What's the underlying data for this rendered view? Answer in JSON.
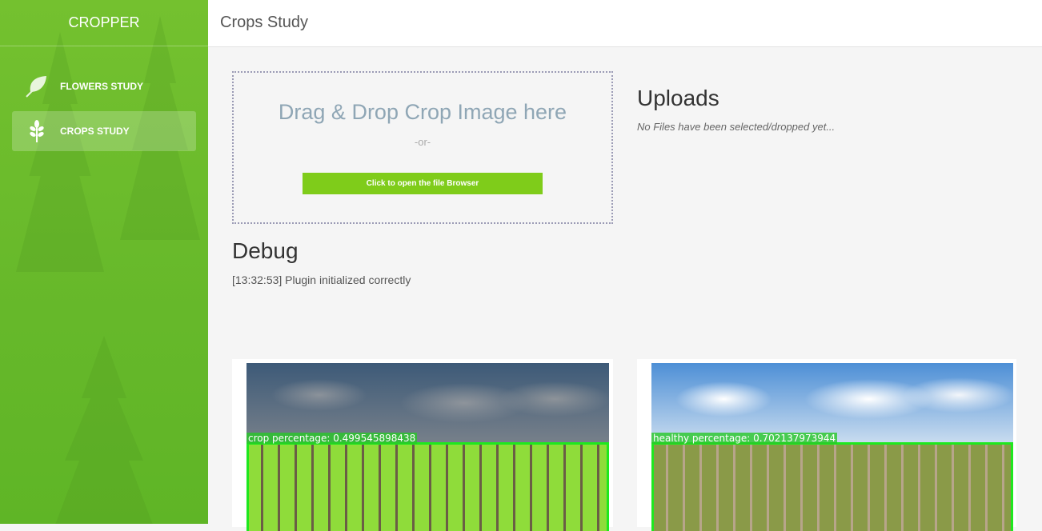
{
  "sidebar": {
    "brand": "CROPPER",
    "items": [
      {
        "label": "FLOWERS STUDY",
        "icon": "leaf-icon",
        "active": false
      },
      {
        "label": "CROPS STUDY",
        "icon": "wheat-icon",
        "active": true
      }
    ]
  },
  "header": {
    "title": "Crops Study"
  },
  "dropzone": {
    "title": "Drag & Drop Crop Image here",
    "or": "-or-",
    "button": "Click to open the file Browser"
  },
  "uploads": {
    "title": "Uploads",
    "empty": "No Files have been selected/dropped yet..."
  },
  "debug": {
    "title": "Debug",
    "log": "[13:32:53] Plugin initialized correctly"
  },
  "results": [
    {
      "label": "crop percentage: 0.499545898438"
    },
    {
      "label": "healthy percentage: 0.702137973944"
    }
  ],
  "colors": {
    "sidebar": "#6cbb2c",
    "button": "#7fcc1a",
    "detection_box": "#1ee81e"
  }
}
